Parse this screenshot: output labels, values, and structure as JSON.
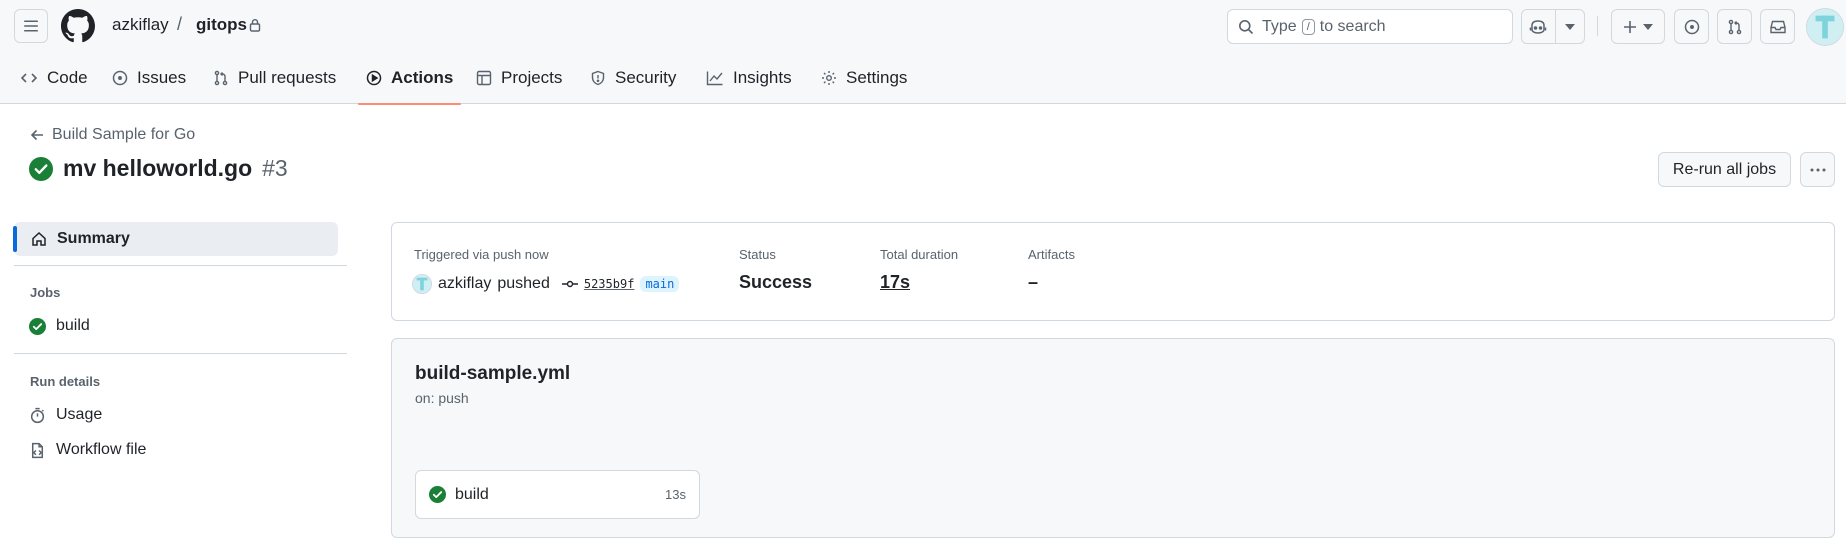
{
  "header": {
    "owner": "azkiflay",
    "separator": "/",
    "repo": "gitops",
    "search_prefix": "Type",
    "search_key": "/",
    "search_suffix": "to search"
  },
  "tabs": [
    {
      "label": "Code"
    },
    {
      "label": "Issues"
    },
    {
      "label": "Pull requests"
    },
    {
      "label": "Actions"
    },
    {
      "label": "Projects"
    },
    {
      "label": "Security"
    },
    {
      "label": "Insights"
    },
    {
      "label": "Settings"
    }
  ],
  "active_tab": "Actions",
  "run": {
    "workflow_back": "Build Sample for Go",
    "title": "mv helloworld.go",
    "number": "#3",
    "rerun_label": "Re-run all jobs"
  },
  "sidebar": {
    "summary": "Summary",
    "jobs_heading": "Jobs",
    "job": "build",
    "run_details_heading": "Run details",
    "usage": "Usage",
    "workflow_file": "Workflow file"
  },
  "summary": {
    "trigger_label": "Triggered via push now",
    "actor": "azkiflay",
    "action": "pushed",
    "commit": "5235b9f",
    "branch": "main",
    "status_label": "Status",
    "status_value": "Success",
    "duration_label": "Total duration",
    "duration_value": "17s",
    "artifacts_label": "Artifacts",
    "artifacts_value": "–"
  },
  "workflow": {
    "file": "build-sample.yml",
    "on": "on: push",
    "job_name": "build",
    "job_time": "13s"
  },
  "colors": {
    "success": "#1a7f37",
    "accent": "#0969da",
    "active_tab_underline": "#fd8c73"
  }
}
